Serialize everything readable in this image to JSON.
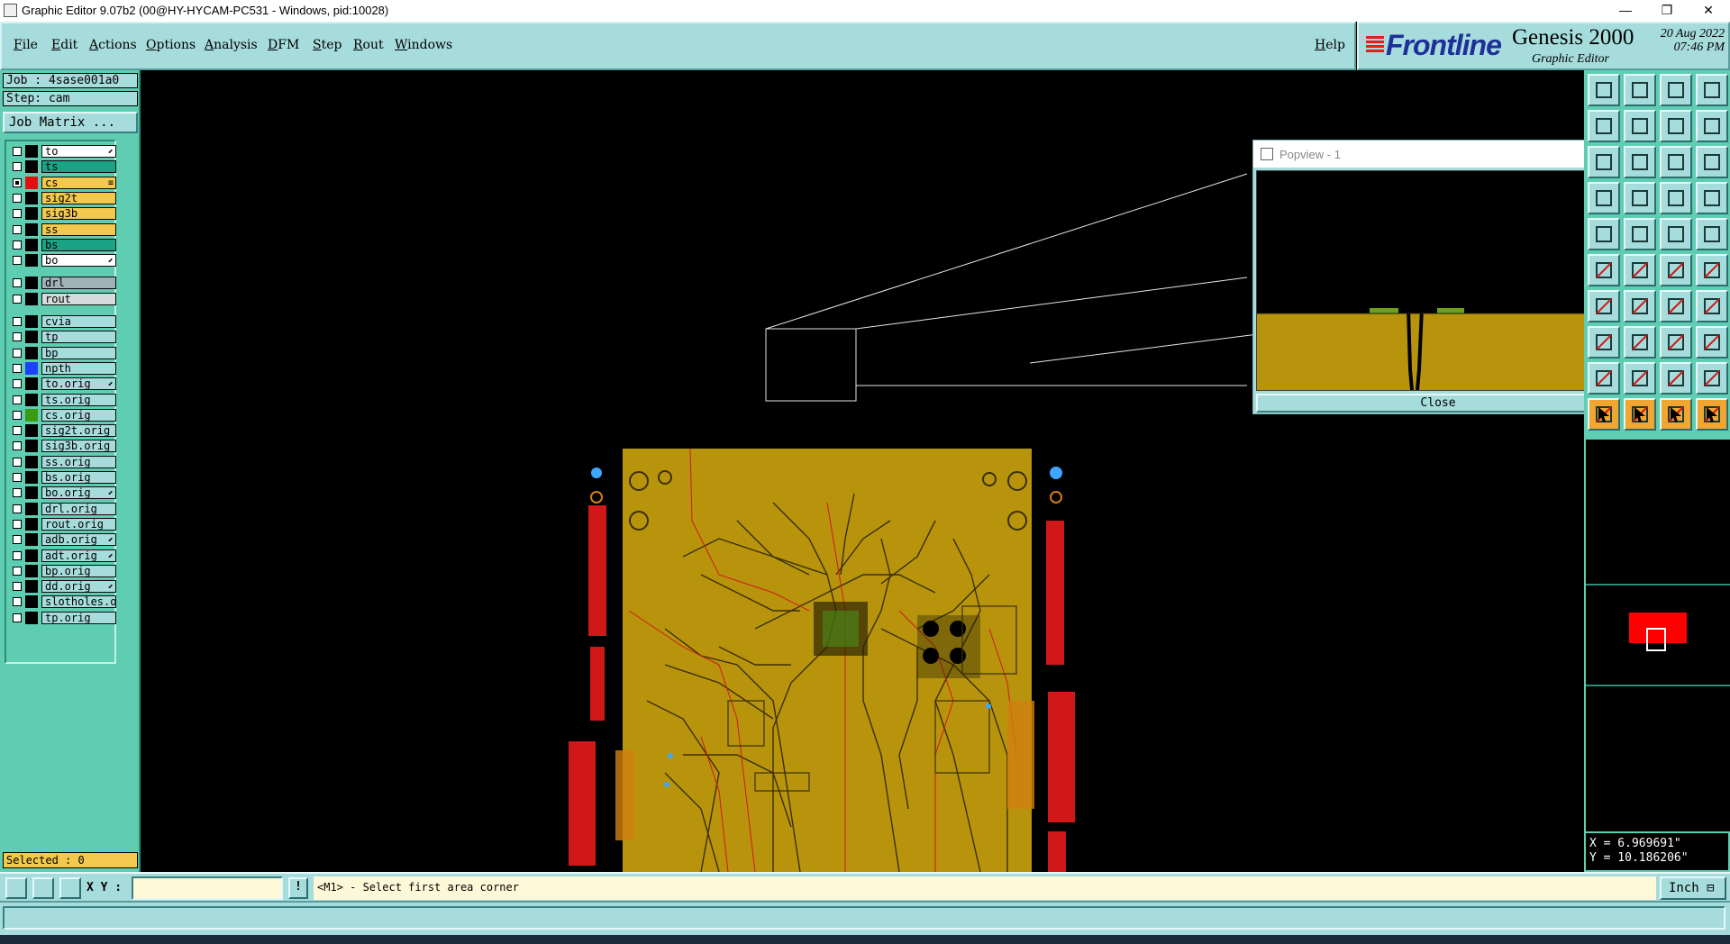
{
  "window": {
    "title": "Graphic Editor 9.07b2 (00@HY-HYCAM-PC531 - Windows, pid:10028)",
    "minimize": "—",
    "restore": "❐",
    "close": "✕"
  },
  "menu": {
    "items": [
      "File",
      "Edit",
      "Actions",
      "Options",
      "Analysis",
      "DFM",
      "Step",
      "Rout",
      "Windows"
    ],
    "help": "Help"
  },
  "brand": {
    "logo": "Frontline",
    "product": "Genesis 2000",
    "subtitle": "Graphic Editor",
    "date": "20 Aug 2022",
    "time": "07:46 PM"
  },
  "job": {
    "job_label": "Job : 4sase001a0",
    "step_label": "Step: cam",
    "matrix_button": "Job Matrix ..."
  },
  "layers": [
    {
      "name": "to",
      "bg": "#ffffff",
      "color": "#000000",
      "checked": false,
      "mark": "⬋"
    },
    {
      "name": "ts",
      "bg": "#1aa384",
      "color": "#000000",
      "checked": false,
      "mark": ""
    },
    {
      "name": "cs",
      "bg": "#f2c94c",
      "color": "#e01010",
      "checked": true,
      "mark": "≡"
    },
    {
      "name": "sig2t",
      "bg": "#f2c94c",
      "color": "#000000",
      "checked": false,
      "mark": ""
    },
    {
      "name": "sig3b",
      "bg": "#f2c94c",
      "color": "#000000",
      "checked": false,
      "mark": ""
    },
    {
      "name": "ss",
      "bg": "#f2c94c",
      "color": "#000000",
      "checked": false,
      "mark": ""
    },
    {
      "name": "bs",
      "bg": "#1aa384",
      "color": "#000000",
      "checked": false,
      "mark": ""
    },
    {
      "name": "bo",
      "bg": "#ffffff",
      "color": "#000000",
      "checked": false,
      "mark": "⬋"
    },
    {
      "name": "drl",
      "bg": "#9fb2b8",
      "color": "#000000",
      "checked": false,
      "mark": "",
      "gap": true
    },
    {
      "name": "rout",
      "bg": "#d6dcdc",
      "color": "#000000",
      "checked": false,
      "mark": ""
    },
    {
      "name": "cvia",
      "bg": "#a7dcdc",
      "color": "#000000",
      "checked": false,
      "mark": "",
      "gap": true
    },
    {
      "name": "tp",
      "bg": "#a7dcdc",
      "color": "#000000",
      "checked": false,
      "mark": ""
    },
    {
      "name": "bp",
      "bg": "#a7dcdc",
      "color": "#000000",
      "checked": false,
      "mark": ""
    },
    {
      "name": "npth",
      "bg": "#a7dcdc",
      "color": "#1e40ff",
      "checked": false,
      "mark": ""
    },
    {
      "name": "to.orig",
      "bg": "#a7dcdc",
      "color": "#000000",
      "checked": false,
      "mark": "⬋"
    },
    {
      "name": "ts.orig",
      "bg": "#a7dcdc",
      "color": "#000000",
      "checked": false,
      "mark": ""
    },
    {
      "name": "cs.orig",
      "bg": "#a7dcdc",
      "color": "#3a9a10",
      "checked": false,
      "mark": ""
    },
    {
      "name": "sig2t.orig",
      "bg": "#a7dcdc",
      "color": "#000000",
      "checked": false,
      "mark": ""
    },
    {
      "name": "sig3b.orig",
      "bg": "#a7dcdc",
      "color": "#000000",
      "checked": false,
      "mark": ""
    },
    {
      "name": "ss.orig",
      "bg": "#a7dcdc",
      "color": "#000000",
      "checked": false,
      "mark": ""
    },
    {
      "name": "bs.orig",
      "bg": "#a7dcdc",
      "color": "#000000",
      "checked": false,
      "mark": ""
    },
    {
      "name": "bo.orig",
      "bg": "#a7dcdc",
      "color": "#000000",
      "checked": false,
      "mark": "⬋"
    },
    {
      "name": "drl.orig",
      "bg": "#a7dcdc",
      "color": "#000000",
      "checked": false,
      "mark": ""
    },
    {
      "name": "rout.orig",
      "bg": "#a7dcdc",
      "color": "#000000",
      "checked": false,
      "mark": ""
    },
    {
      "name": "adb.orig",
      "bg": "#a7dcdc",
      "color": "#000000",
      "checked": false,
      "mark": "⬋"
    },
    {
      "name": "adt.orig",
      "bg": "#a7dcdc",
      "color": "#000000",
      "checked": false,
      "mark": "⬋"
    },
    {
      "name": "bp.orig",
      "bg": "#a7dcdc",
      "color": "#000000",
      "checked": false,
      "mark": ""
    },
    {
      "name": "dd.orig",
      "bg": "#a7dcdc",
      "color": "#000000",
      "checked": false,
      "mark": "⬋"
    },
    {
      "name": "slotholes.or",
      "bg": "#a7dcdc",
      "color": "#000000",
      "checked": false,
      "mark": ""
    },
    {
      "name": "tp.orig",
      "bg": "#a7dcdc",
      "color": "#000000",
      "checked": false,
      "mark": ""
    }
  ],
  "status": {
    "selected": "Selected : 0",
    "xy_label": "X Y :",
    "xy_value": "",
    "prompt": "<M1> - Select first area corner",
    "unit": "Inch ⊟"
  },
  "coords": {
    "x": "X = 6.969691\"",
    "y": "Y = 10.186206\""
  },
  "popview": {
    "title": "Popview - 1",
    "close": "Close"
  },
  "colors": {
    "panel": "#a7dcdc",
    "layerbg": "#5ecdb1",
    "board": "#b8940c",
    "trace_dark": "#3a2e05",
    "trace_red": "#d01818",
    "status_yellow": "#f2c94c"
  },
  "toolbar_icons": [
    "zoom-home-icon",
    "zoom-in-icon",
    "home-icon",
    "split-view-icon",
    "pan-left-icon",
    "pan-right-icon",
    "zoom-reset-icon",
    "layout-icon",
    "popview-icon",
    "fit-icon",
    "zoom-1to1-icon",
    "help-icon",
    "snap-icon",
    "grid-icon",
    "measure-icon",
    "measure-alt-icon",
    "move-icon",
    "highlight-icon",
    "ruler-icon",
    "pad-icon",
    "copy-icon",
    "cross-icon",
    "connect-icon",
    "connect-alt-icon",
    "paste-icon",
    "line-icon",
    "arc-icon",
    "feature-icon",
    "select-icon",
    "minus-icon",
    "box-select-icon",
    "flatten-icon",
    "nav-icon",
    "triangle-icon",
    "triangle-bar-icon",
    "triangle-dot-icon",
    "pointer-icon",
    "pointer-alt-icon",
    "pointer-hand-icon",
    "pointer-graph-icon"
  ]
}
